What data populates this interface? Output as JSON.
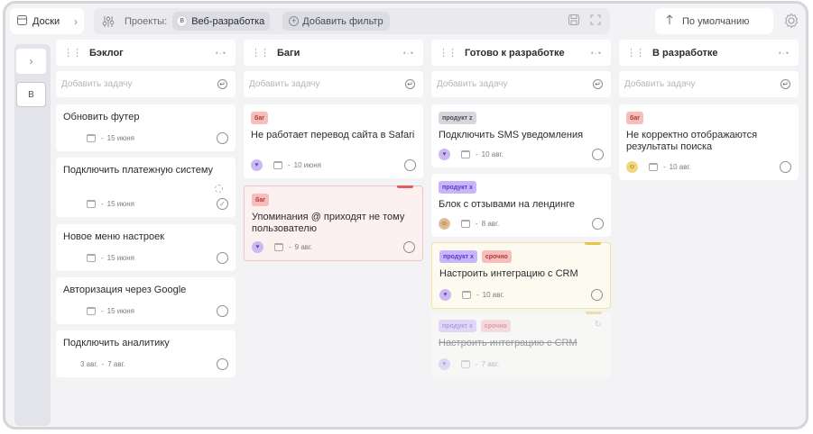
{
  "breadcrumb": {
    "label": "Доски",
    "icon": "board-icon",
    "chevron": "chevron-right-icon"
  },
  "filters": {
    "projects_label": "Проекты:",
    "project_chip": {
      "avatar": "В",
      "name": "Веб-разработка"
    },
    "add_filter_label": "Добавить фильтр"
  },
  "sort": {
    "label": "По умолчанию"
  },
  "sidebar": {
    "collapse_icon": "chevron-right-icon",
    "badge": "В"
  },
  "columns": [
    {
      "title": "Бэклог",
      "add_placeholder": "Добавить задачу",
      "cards": [
        {
          "title": "Обновить футер",
          "date": "15 июня",
          "prefix": "-"
        },
        {
          "title": "Подключить платежную систему",
          "date": "15 июня",
          "prefix": "-",
          "status": "done"
        },
        {
          "title": "Новое меню настроек",
          "date": "15 июня",
          "prefix": "-"
        },
        {
          "title": "Авторизация через Google",
          "date": "15 июня",
          "prefix": "-"
        },
        {
          "title": "Подключить аналитику",
          "date_start": "3 авг.",
          "date": "7 авг.",
          "prefix": "-"
        }
      ]
    },
    {
      "title": "Баги",
      "add_placeholder": "Добавить задачу",
      "cards": [
        {
          "title": "Не работает перевод сайта в Safari",
          "tags": [
            "баг"
          ],
          "date": "10 июня",
          "prefix": "-"
        },
        {
          "title": "Упоминания @ приходят не тому пользователю",
          "tags": [
            "баг"
          ],
          "date": "9 авг.",
          "prefix": "-"
        }
      ]
    },
    {
      "title": "Готово к разработке",
      "add_placeholder": "Добавить задачу",
      "cards": [
        {
          "title": "Подключить SMS уведомления",
          "tags": [
            "продукт z"
          ],
          "date": "10 авг.",
          "prefix": "-"
        },
        {
          "title": "Блок с отзывами на лендинге",
          "tags": [
            "продукт x"
          ],
          "date": "8 авг.",
          "prefix": "-"
        },
        {
          "title": "Настроить интеграцию с CRM",
          "tags": [
            "продукт x",
            "срочно"
          ],
          "date": "10 авг.",
          "prefix": "-"
        },
        {
          "title": "Настроить интеграцию с CRM",
          "tags": [
            "продукт x",
            "срочно"
          ],
          "date": "7 авг.",
          "prefix": "-"
        }
      ]
    },
    {
      "title": "В разработке",
      "add_placeholder": "Добавить задачу",
      "cards": [
        {
          "title": "Не корректно отображаются результаты поиска",
          "tags": [
            "баг"
          ],
          "date": "10 авг.",
          "prefix": "-"
        }
      ]
    }
  ],
  "colors": {
    "tag_bug": "#f6bdbd",
    "tag_product_x": "#c9b5fb",
    "tag_product_z": "#d6d6dc",
    "accent_red": "#e35b5b",
    "accent_yellow": "#e8c54a"
  }
}
